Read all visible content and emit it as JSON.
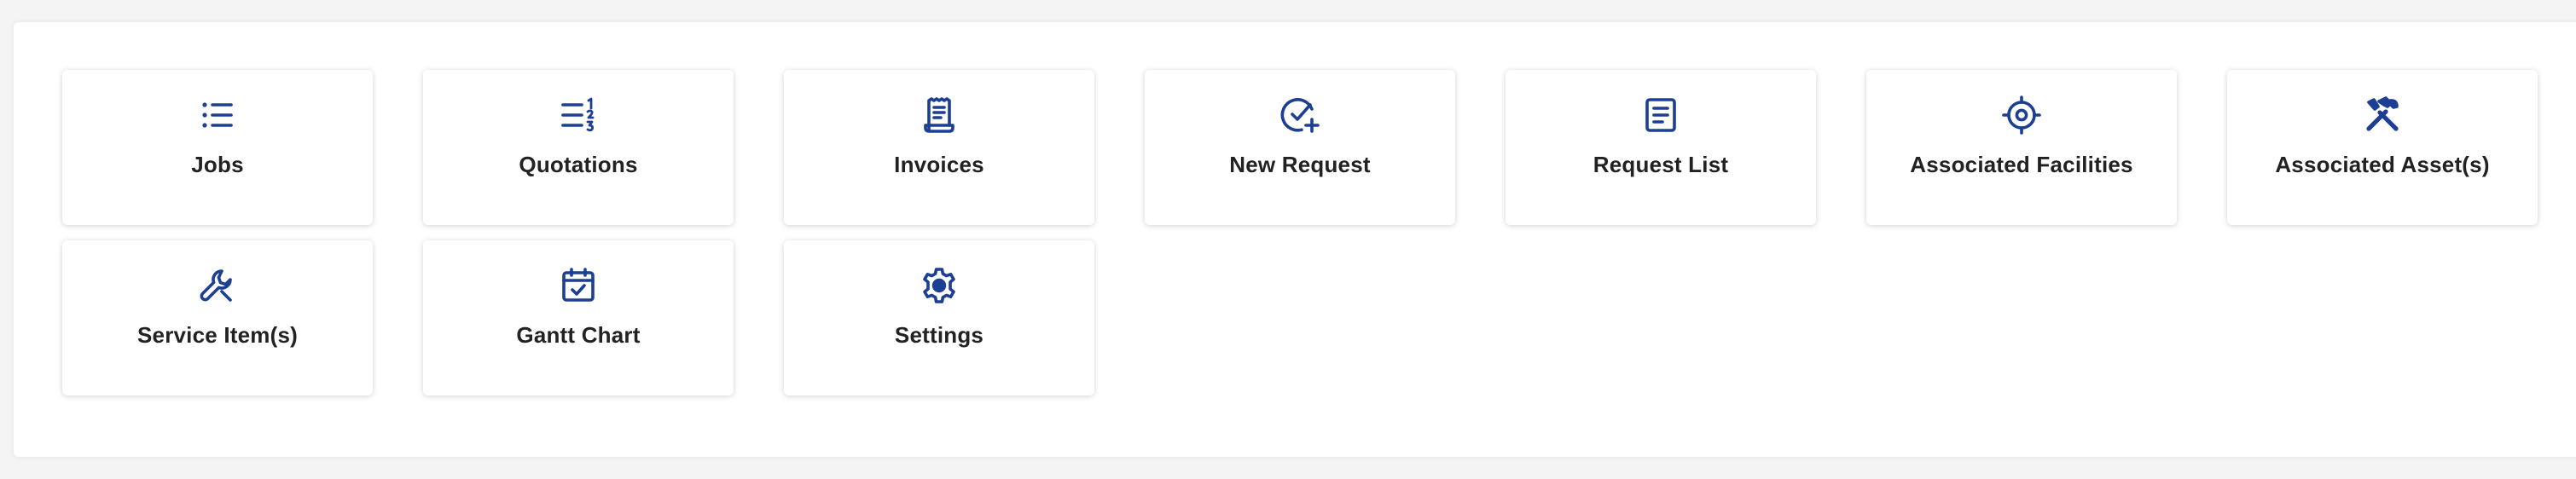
{
  "accent_color": "#1c3f94",
  "tiles": [
    {
      "label": "Jobs",
      "icon": "list-icon"
    },
    {
      "label": "Quotations",
      "icon": "numbered-list-icon"
    },
    {
      "label": "Invoices",
      "icon": "receipt-icon"
    },
    {
      "label": "New Request",
      "icon": "check-plus-icon"
    },
    {
      "label": "Request List",
      "icon": "document-list-icon"
    },
    {
      "label": "Associated Facilities",
      "icon": "target-icon"
    },
    {
      "label": "Associated Asset(s)",
      "icon": "tools-icon"
    },
    {
      "label": "Service Item(s)",
      "icon": "wrench-icon"
    },
    {
      "label": "Gantt Chart",
      "icon": "calendar-check-icon"
    },
    {
      "label": "Settings",
      "icon": "gear-icon"
    }
  ]
}
